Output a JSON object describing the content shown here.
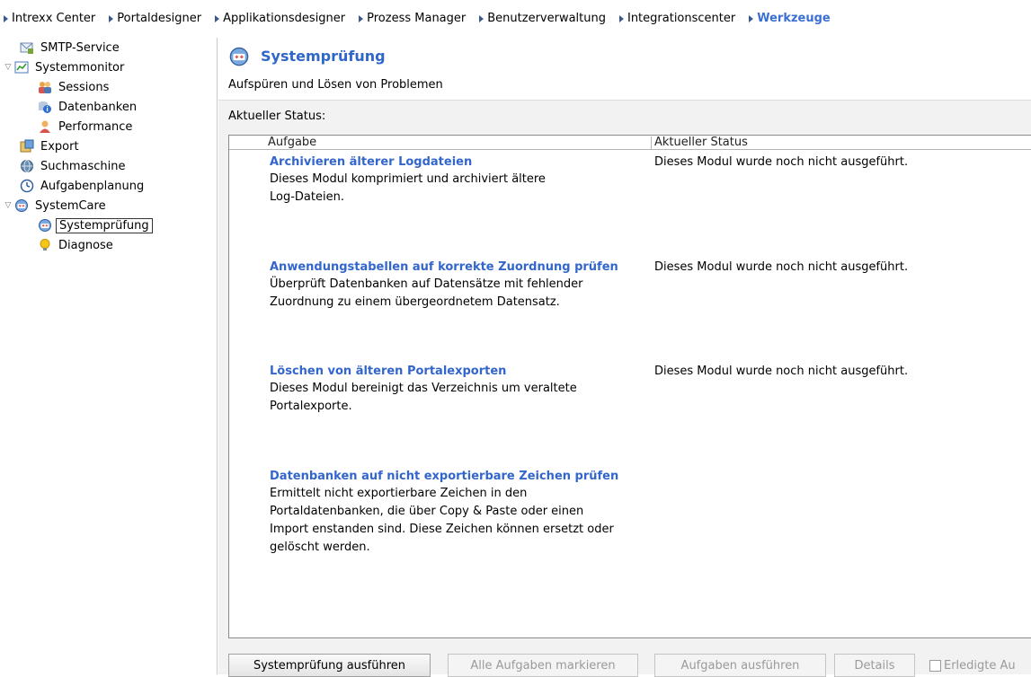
{
  "nav": {
    "items": [
      {
        "label": "Intrexx Center",
        "active": false
      },
      {
        "label": "Portaldesigner",
        "active": false
      },
      {
        "label": "Applikationsdesigner",
        "active": false
      },
      {
        "label": "Prozess Manager",
        "active": false
      },
      {
        "label": "Benutzerverwaltung",
        "active": false
      },
      {
        "label": "Integrationscenter",
        "active": false
      },
      {
        "label": "Werkzeuge",
        "active": true
      }
    ]
  },
  "sidebar": {
    "items": [
      {
        "label": "SMTP-Service",
        "icon": "mail-server-icon"
      },
      {
        "label": "Systemmonitor",
        "icon": "monitor-chart-icon",
        "expanded": true
      },
      {
        "label": "Sessions",
        "icon": "users-icon"
      },
      {
        "label": "Datenbanken",
        "icon": "database-info-icon"
      },
      {
        "label": "Performance",
        "icon": "performance-user-icon"
      },
      {
        "label": "Export",
        "icon": "export-icon"
      },
      {
        "label": "Suchmaschine",
        "icon": "globe-search-icon"
      },
      {
        "label": "Aufgabenplanung",
        "icon": "clock-icon"
      },
      {
        "label": "SystemCare",
        "icon": "systemcare-icon",
        "expanded": true
      },
      {
        "label": "Systemprüfung",
        "icon": "systemcare-icon",
        "selected": true
      },
      {
        "label": "Diagnose",
        "icon": "lightbulb-icon"
      }
    ]
  },
  "main": {
    "title": "Systemprüfung",
    "subtitle": "Aufspüren und Lösen von Problemen",
    "status_label": "Aktueller Status:",
    "columns": {
      "task": "Aufgabe",
      "status": "Aktueller Status"
    },
    "tasks": [
      {
        "title": "Archivieren älterer Logdateien",
        "desc": "Dieses Modul komprimiert und archiviert ältere\nLog-Dateien.",
        "status": "Dieses Modul wurde noch nicht ausgeführt."
      },
      {
        "title": "Anwendungstabellen auf korrekte Zuordnung prüfen",
        "desc": "Überprüft Datenbanken auf Datensätze mit fehlender\nZuordnung zu einem übergeordnetem Datensatz.",
        "status": "Dieses Modul wurde noch nicht ausgeführt."
      },
      {
        "title": "Löschen von älteren Portalexporten",
        "desc": "Dieses Modul bereinigt das Verzeichnis um veraltete\nPortalexporte.",
        "status": "Dieses Modul wurde noch nicht ausgeführt."
      },
      {
        "title": "Datenbanken auf nicht exportierbare Zeichen prüfen",
        "desc": "Ermittelt nicht exportierbare Zeichen in den\nPortaldatenbanken, die über Copy & Paste oder einen\nImport enstanden sind. Diese Zeichen können ersetzt oder\ngelöscht werden.",
        "status": ""
      }
    ]
  },
  "footer": {
    "run_check": "Systemprüfung ausführen",
    "mark_all": "Alle Aufgaben markieren",
    "run_tasks": "Aufgaben ausführen",
    "details": "Details",
    "completed_checkbox": "Erledigte Au"
  },
  "colors": {
    "accent": "#3366cc",
    "active_nav": "#3b6fd6"
  }
}
